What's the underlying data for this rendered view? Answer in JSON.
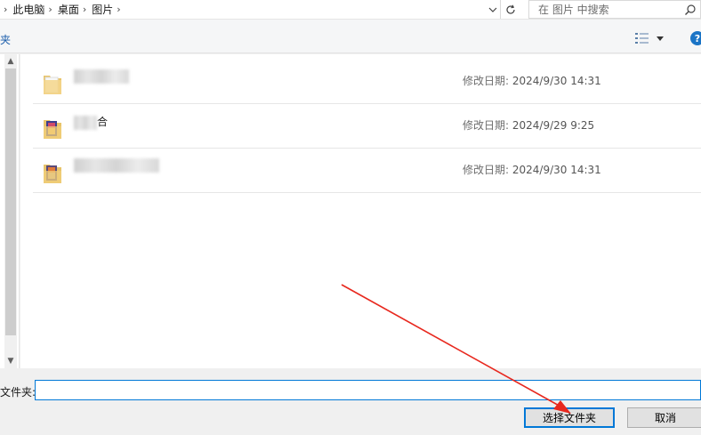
{
  "address_bar": {
    "breadcrumb": [
      "此电脑",
      "桌面",
      "图片"
    ],
    "separator": "›"
  },
  "search": {
    "placeholder": "在 图片 中搜索"
  },
  "toolbar": {
    "new_folder_label": "夹",
    "help_label": "?"
  },
  "files": [
    {
      "icon": "folder-icon",
      "name_visible": "",
      "date_label": "修改日期:",
      "date_value": "2024/9/30 14:31"
    },
    {
      "icon": "image-folder-icon",
      "name_visible": "合",
      "date_label": "修改日期:",
      "date_value": "2024/9/29 9:25"
    },
    {
      "icon": "image-folder-icon",
      "name_visible": "",
      "date_label": "修改日期:",
      "date_value": "2024/9/30 14:31"
    }
  ],
  "footer": {
    "filename_label": "文件夹:",
    "filename_value": "",
    "select_button": "选择文件夹",
    "cancel_button": "取消"
  },
  "colors": {
    "accent": "#0078d7",
    "link": "#1b5dab",
    "annotation_arrow": "#e8281e"
  }
}
